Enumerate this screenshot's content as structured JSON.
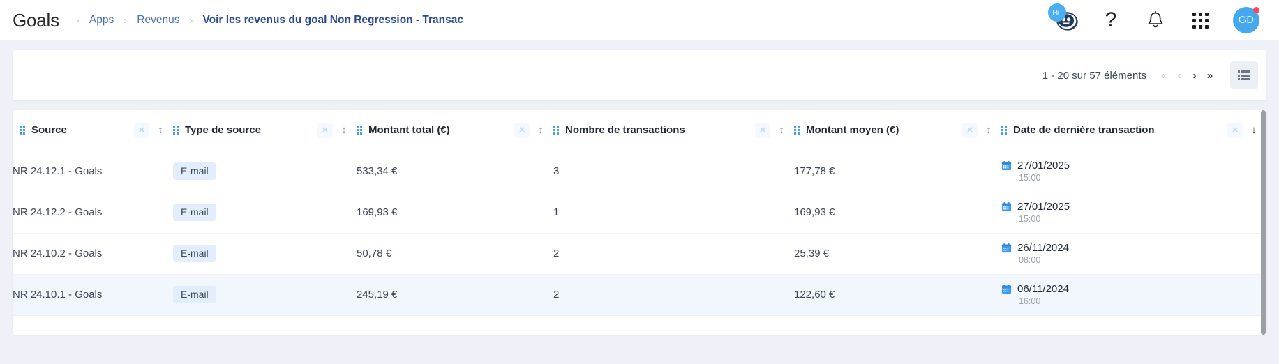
{
  "header": {
    "title": "Goals",
    "breadcrumb": [
      {
        "label": "Apps",
        "current": false
      },
      {
        "label": "Revenus",
        "current": false
      },
      {
        "label": "Voir les revenus du goal Non Regression - Transac",
        "current": true
      }
    ],
    "separator": "›",
    "actions": {
      "chatbot_badge": "Hi !",
      "help_label": "?",
      "avatar_initials": "GD"
    },
    "icons": {
      "chatbot": "chatbot-icon",
      "help": "help-icon",
      "notifications": "bell-icon",
      "apps": "grid-apps-icon",
      "avatar": "user-avatar"
    },
    "colors": {
      "accent_blue": "#44a9ef",
      "breadcrumb_link": "#4a6fb5",
      "breadcrumb_current": "#2b4a94",
      "notification_dot": "#ff4757"
    }
  },
  "toolbar": {
    "pagination_label": "1 - 20 sur 57 éléments",
    "first_label": "«",
    "prev_label": "‹",
    "next_label": "›",
    "last_label": "»",
    "view_toggle_icon": "list-view-icon",
    "range_start": 1,
    "range_end": 20,
    "total": 57
  },
  "table": {
    "columns": [
      {
        "label": "Source",
        "sort": "none",
        "sort_glyph": "↕"
      },
      {
        "label": "Type de source",
        "sort": "none",
        "sort_glyph": "↕"
      },
      {
        "label": "Montant total (€)",
        "sort": "none",
        "sort_glyph": "↕"
      },
      {
        "label": "Nombre de transactions",
        "sort": "none",
        "sort_glyph": "↕"
      },
      {
        "label": "Montant moyen (€)",
        "sort": "none",
        "sort_glyph": "↕"
      },
      {
        "label": "Date de dernière transaction",
        "sort": "desc",
        "sort_glyph": "↓"
      }
    ],
    "clear_glyph": "×",
    "rows": [
      {
        "source": "NR 24.12.1 - Goals",
        "type": "E-mail",
        "montant_total": "533,34 €",
        "nb_transactions": "3",
        "montant_moyen": "177,78 €",
        "date": "27/01/2025",
        "time": "15:00",
        "highlighted": false
      },
      {
        "source": "NR 24.12.2 - Goals",
        "type": "E-mail",
        "montant_total": "169,93 €",
        "nb_transactions": "1",
        "montant_moyen": "169,93 €",
        "date": "27/01/2025",
        "time": "15:00",
        "highlighted": false
      },
      {
        "source": "NR 24.10.2 - Goals",
        "type": "E-mail",
        "montant_total": "50,78 €",
        "nb_transactions": "2",
        "montant_moyen": "25,39 €",
        "date": "26/11/2024",
        "time": "08:00",
        "highlighted": false
      },
      {
        "source": "NR 24.10.1 - Goals",
        "type": "E-mail",
        "montant_total": "245,19 €",
        "nb_transactions": "2",
        "montant_moyen": "122,60 €",
        "date": "06/11/2024",
        "time": "16:00",
        "highlighted": true
      }
    ]
  }
}
